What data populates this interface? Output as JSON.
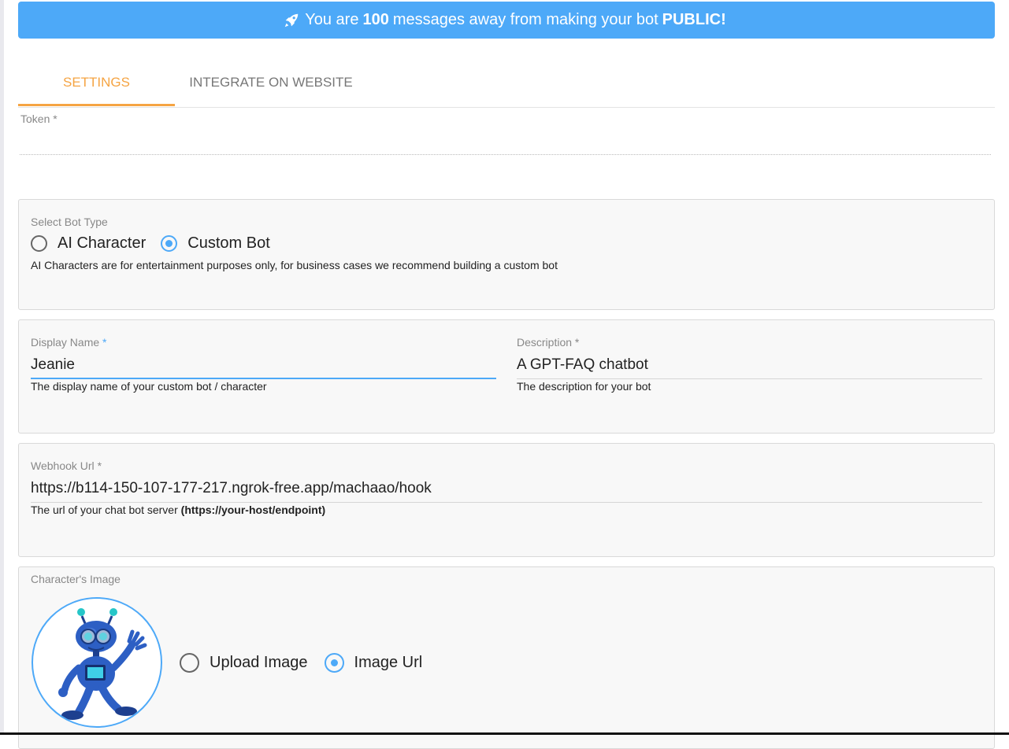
{
  "banner": {
    "prefix": "You are",
    "count": "100",
    "middle": "messages away from making your bot",
    "highlight": "PUBLIC!",
    "icon": "rocket-icon"
  },
  "tabs": [
    {
      "label": "SETTINGS",
      "active": true
    },
    {
      "label": "INTEGRATE ON WEBSITE",
      "active": false
    }
  ],
  "token": {
    "label": "Token",
    "required_mark": "*",
    "value": ""
  },
  "bot_type": {
    "label": "Select Bot Type",
    "options": [
      {
        "label": "AI Character",
        "selected": false
      },
      {
        "label": "Custom Bot",
        "selected": true
      }
    ],
    "hint": "AI Characters are for entertainment purposes only, for business cases we recommend building a custom bot"
  },
  "display_name": {
    "label": "Display Name",
    "required_mark": "*",
    "value": "Jeanie",
    "hint": "The display name of your custom bot / character"
  },
  "description": {
    "label": "Description",
    "required_mark": "*",
    "value": "A GPT-FAQ chatbot",
    "hint": "The description for your bot"
  },
  "webhook": {
    "label": "Webhook Url",
    "required_mark": "*",
    "value": "https://b114-150-107-177-217.ngrok-free.app/machaao/hook",
    "hint_prefix": "The url of your chat bot server",
    "hint_bold": "(https://your-host/endpoint)"
  },
  "image": {
    "label": "Character's Image",
    "options": [
      {
        "label": "Upload Image",
        "selected": false
      },
      {
        "label": "Image Url",
        "selected": true
      }
    ]
  },
  "colors": {
    "accent": "#4da9f8",
    "active_tab": "#f5a443"
  }
}
